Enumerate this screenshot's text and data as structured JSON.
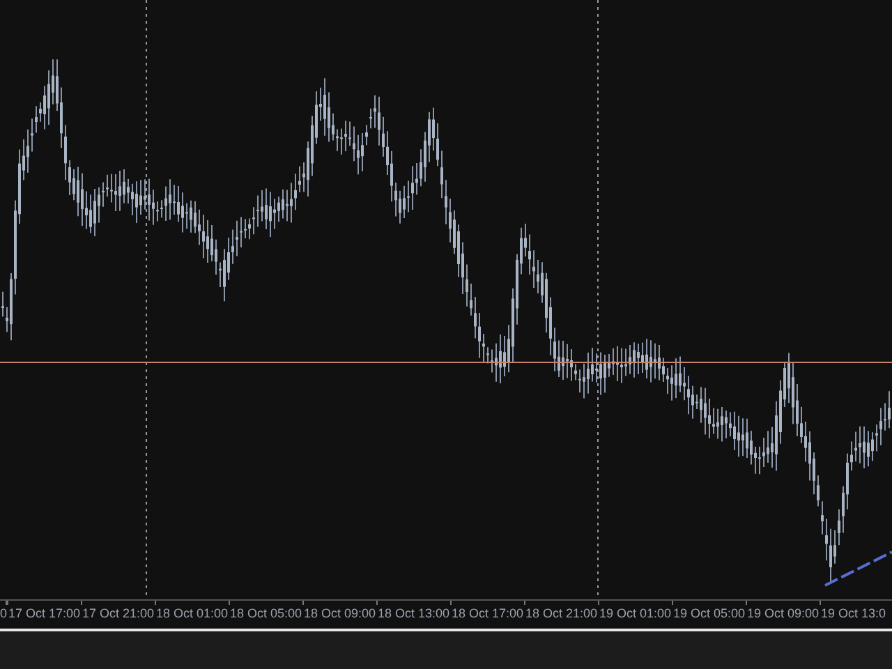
{
  "time_axis": {
    "labels": [
      "0",
      "17 Oct 17:00",
      "17 Oct 21:00",
      "18 Oct 01:00",
      "18 Oct 05:00",
      "18 Oct 09:00",
      "18 Oct 13:00",
      "18 Oct 17:00",
      "18 Oct 21:00",
      "19 Oct 01:00",
      "19 Oct 05:00",
      "19 Oct 09:00",
      "19 Oct 13:0"
    ]
  }
}
